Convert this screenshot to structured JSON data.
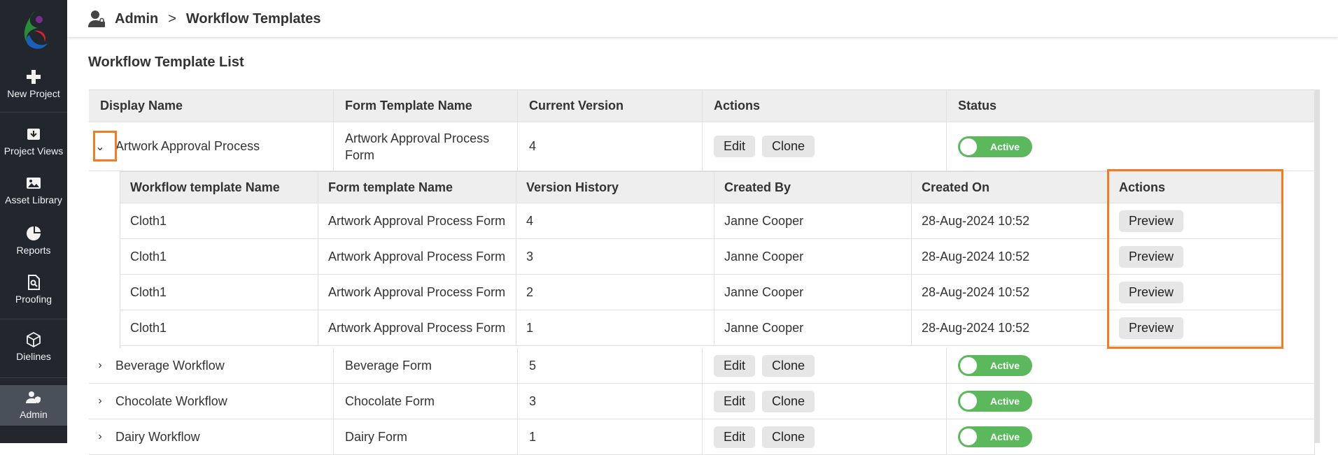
{
  "sidebar": {
    "items": [
      {
        "label": "New Project",
        "icon": "plus-icon"
      },
      {
        "label": "Project Views",
        "icon": "download-box-icon"
      },
      {
        "label": "Asset Library",
        "icon": "image-icon"
      },
      {
        "label": "Reports",
        "icon": "pie-chart-icon"
      },
      {
        "label": "Proofing",
        "icon": "document-search-icon"
      },
      {
        "label": "Dielines",
        "icon": "cube-icon"
      },
      {
        "label": "Admin",
        "icon": "user-shield-icon"
      }
    ],
    "active": "Admin"
  },
  "breadcrumb": {
    "root": "Admin",
    "separator": ">",
    "current": "Workflow Templates"
  },
  "page_title": "Workflow Template List",
  "table": {
    "columns": [
      "Display Name",
      "Form Template Name",
      "Current Version",
      "Actions",
      "Status"
    ],
    "edit_label": "Edit",
    "clone_label": "Clone",
    "rows": [
      {
        "display_name": "Artwork Approval Process",
        "form": "Artwork Approval Process Form",
        "version": "4",
        "status": "Active",
        "expanded": true
      },
      {
        "display_name": "Beverage Workflow",
        "form": "Beverage Form",
        "version": "5",
        "status": "Active",
        "expanded": false
      },
      {
        "display_name": "Chocolate Workflow",
        "form": "Chocolate Form",
        "version": "3",
        "status": "Active",
        "expanded": false
      },
      {
        "display_name": "Dairy Workflow",
        "form": "Dairy Form",
        "version": "1",
        "status": "Active",
        "expanded": false
      }
    ]
  },
  "subtable": {
    "columns": [
      "Workflow template Name",
      "Form template Name",
      "Version History",
      "Created By",
      "Created On",
      "Actions"
    ],
    "preview_label": "Preview",
    "rows": [
      {
        "name": "Cloth1",
        "form": "Artwork Approval Process Form",
        "version": "4",
        "created_by": "Janne Cooper",
        "created_on": "28-Aug-2024 10:52"
      },
      {
        "name": "Cloth1",
        "form": "Artwork Approval Process Form",
        "version": "3",
        "created_by": "Janne Cooper",
        "created_on": "28-Aug-2024 10:52"
      },
      {
        "name": "Cloth1",
        "form": "Artwork Approval Process Form",
        "version": "2",
        "created_by": "Janne Cooper",
        "created_on": "28-Aug-2024 10:52"
      },
      {
        "name": "Cloth1",
        "form": "Artwork Approval Process Form",
        "version": "1",
        "created_by": "Janne Cooper",
        "created_on": "28-Aug-2024 10:52"
      }
    ]
  },
  "colors": {
    "accent": "#5cb85c",
    "highlight": "#f07d25",
    "sidebar": "#22272e"
  }
}
